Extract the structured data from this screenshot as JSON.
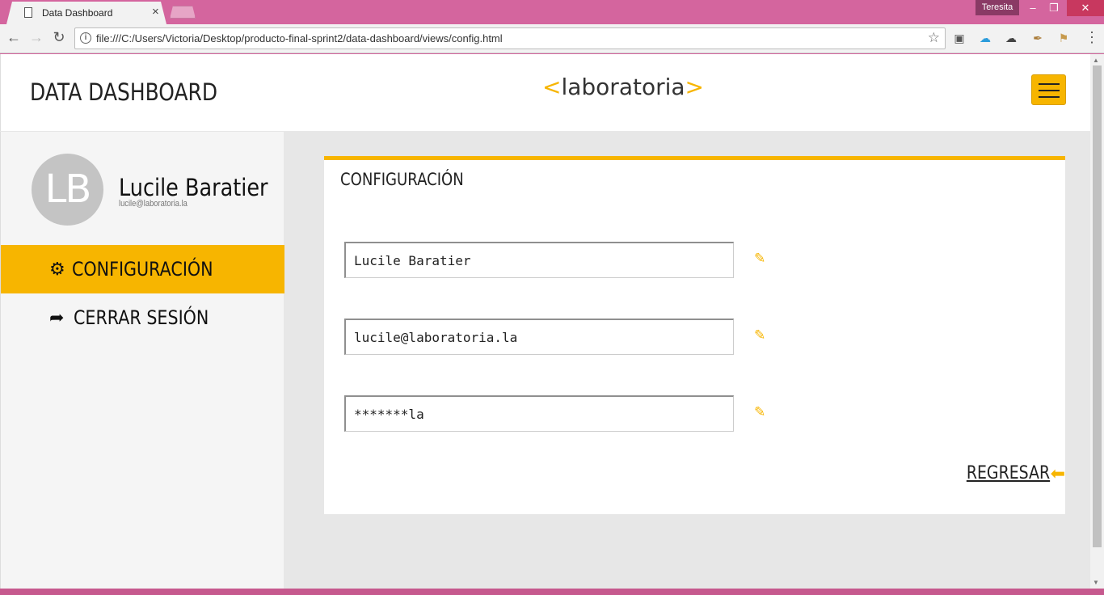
{
  "browser": {
    "tab_title": "Data Dashboard",
    "tab_close": "×",
    "profile_name": "Teresita",
    "win_min": "–",
    "win_max": "❐",
    "win_close": "✕",
    "url": "file:///C:/Users/Victoria/Desktop/producto-final-sprint2/data-dashboard/views/config.html",
    "nav_back": "←",
    "nav_forward": "→",
    "nav_reload": "↻",
    "star": "☆",
    "menu": "⋮"
  },
  "header": {
    "brand": "DATA DASHBOARD",
    "logo_open": "<",
    "logo_text": "laboratoria",
    "logo_close": ">"
  },
  "sidebar": {
    "avatar_initials": "LB",
    "user_name": "Lucile Baratier",
    "user_email": "lucile@laboratoria.la",
    "items": [
      {
        "label": "CONFIGURACIÓN",
        "icon": "gear-icon",
        "glyph": "⚙",
        "active": true
      },
      {
        "label": "CERRAR SESIÓN",
        "icon": "sign-out-icon",
        "glyph": "➦",
        "active": false
      }
    ]
  },
  "config": {
    "title": "CONFIGURACIÓN",
    "fields": [
      {
        "name": "name-field",
        "value": "Lucile Baratier"
      },
      {
        "name": "email-field",
        "value": "lucile@laboratoria.la"
      },
      {
        "name": "password-field",
        "value": "*******la"
      }
    ],
    "edit_glyph": "✎",
    "back_label": "REGRESAR ",
    "back_glyph": "⬅"
  },
  "colors": {
    "accent": "#f7b500",
    "chrome": "#d4659e",
    "sidebar_bg": "#f5f5f5",
    "content_bg": "#e7e7e7"
  }
}
